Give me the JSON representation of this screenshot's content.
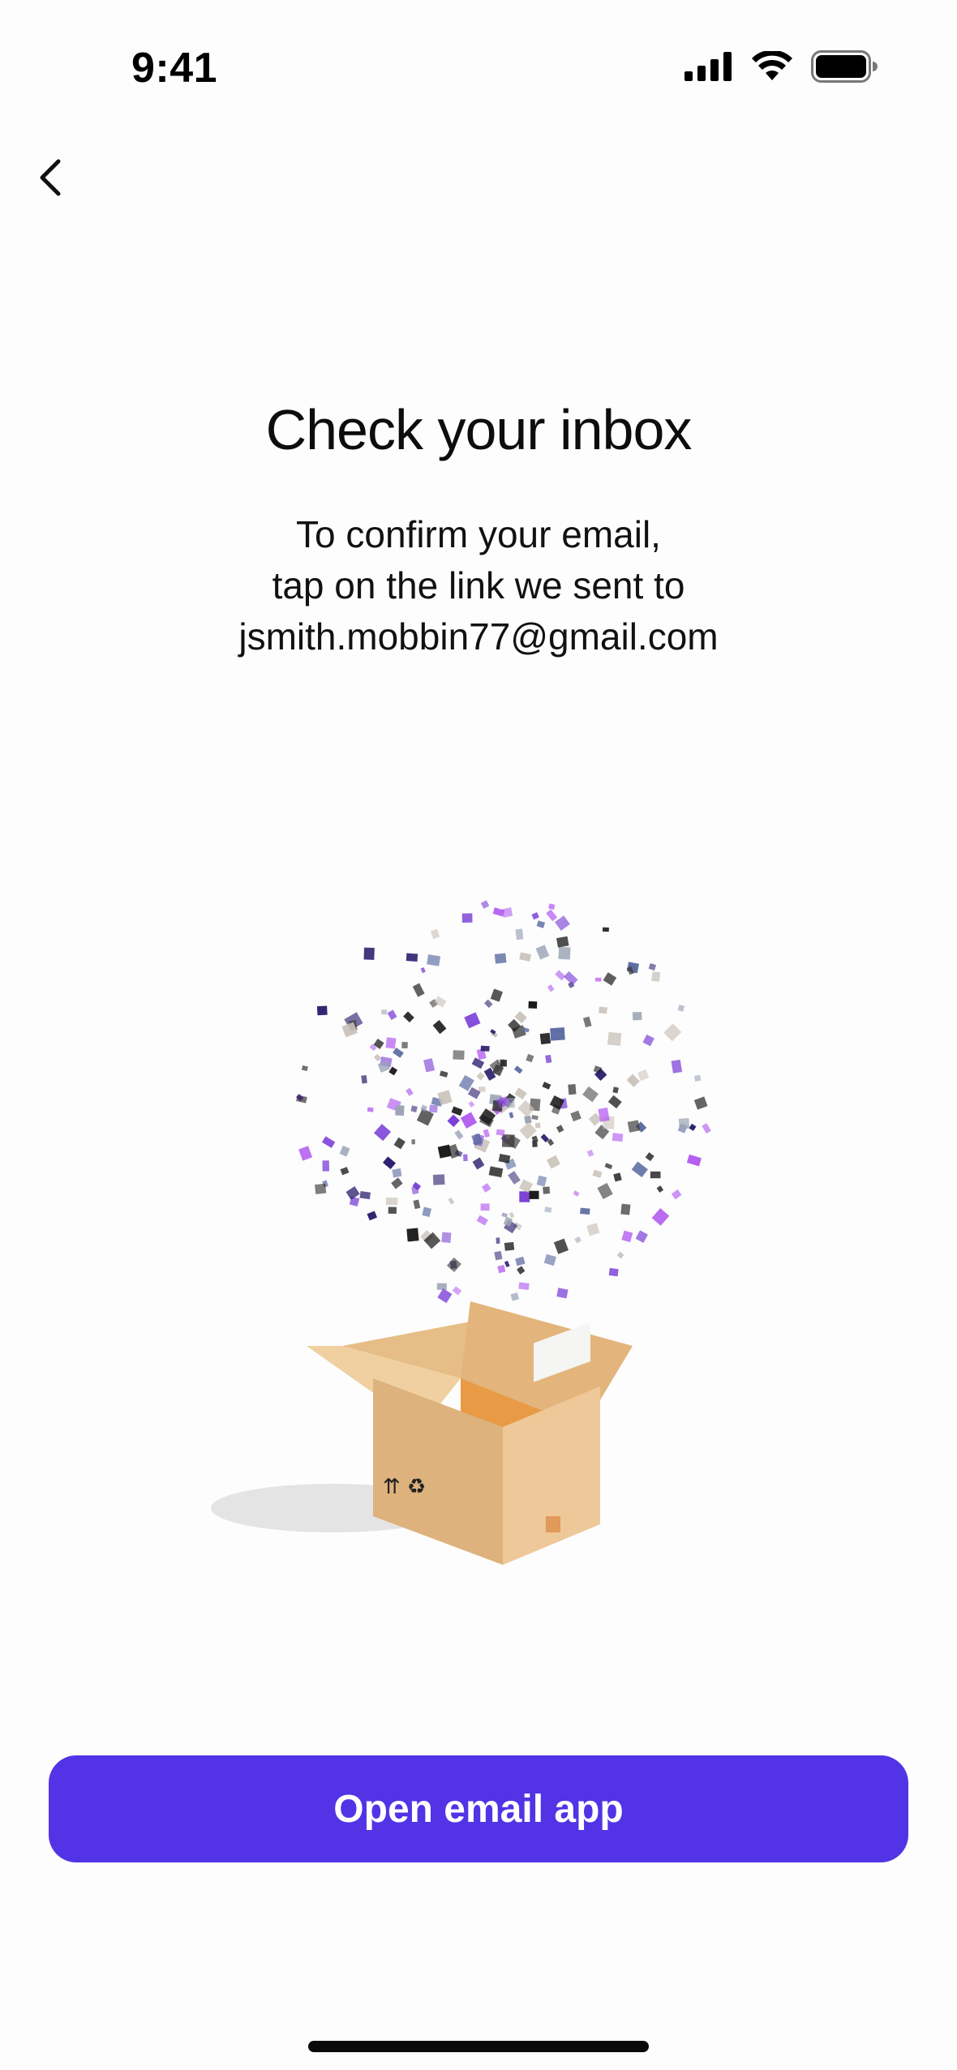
{
  "status_bar": {
    "time": "9:41",
    "icons": [
      "cellular-signal-icon",
      "wifi-icon",
      "battery-icon"
    ]
  },
  "nav": {
    "back_icon": "chevron-left-icon"
  },
  "content": {
    "title": "Check your inbox",
    "subtitle_lines": [
      "To confirm your email,",
      "tap on the link we sent to",
      "jsmith.mobbin77@gmail.com"
    ],
    "illustration": "open-box-confetti-illustration"
  },
  "actions": {
    "primary_label": "Open email app"
  },
  "colors": {
    "accent": "#5233e6",
    "background": "#fdfdfd",
    "text": "#111111"
  }
}
